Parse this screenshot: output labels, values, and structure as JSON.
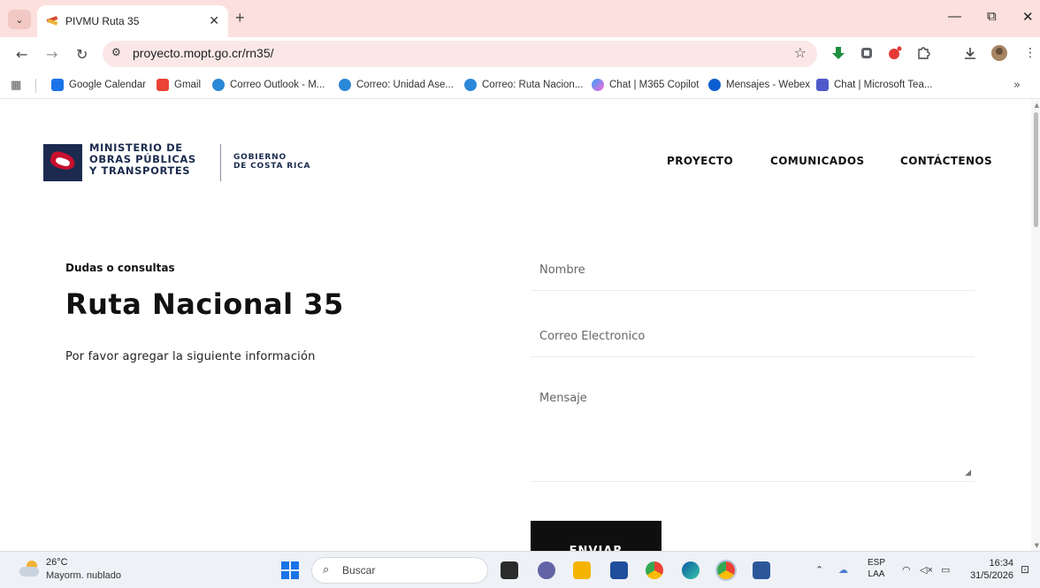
{
  "browser": {
    "tab_title": "PIVMU Ruta 35",
    "tab_close": "✕",
    "new_tab": "+",
    "url": "proyecto.mopt.go.cr/rn35/",
    "window_controls": {
      "minimize": "—",
      "restore": "⧉",
      "close": "✕"
    },
    "bookmarks": [
      {
        "label": "Google Calendar",
        "icon": "calendar-icon",
        "color": "#1a73e8"
      },
      {
        "label": "Gmail",
        "icon": "gmail-icon",
        "color": "#ea4335"
      },
      {
        "label": "Correo Outlook - M...",
        "icon": "outlook-icon",
        "color": "#2b88d8"
      },
      {
        "label": "Correo: Unidad Ase...",
        "icon": "outlook-icon",
        "color": "#2b88d8"
      },
      {
        "label": "Correo: Ruta Nacion...",
        "icon": "outlook-icon",
        "color": "#2b88d8"
      },
      {
        "label": "Chat | M365 Copilot",
        "icon": "copilot-icon",
        "color": "#7b61ff"
      },
      {
        "label": "Mensajes - Webex",
        "icon": "webex-icon",
        "color": "#0d5fd1"
      },
      {
        "label": "Chat | Microsoft Tea...",
        "icon": "teams-icon",
        "color": "#5059c9"
      }
    ],
    "bookmarks_overflow": "»"
  },
  "site": {
    "logo": {
      "ministry_lines": [
        "MINISTERIO DE",
        "OBRAS PÚBLICAS",
        "Y TRANSPORTES"
      ],
      "gov_lines": [
        "GOBIERNO",
        "DE COSTA RICA"
      ]
    },
    "nav": [
      "PROYECTO",
      "COMUNICADOS",
      "CONTÁCTENOS"
    ]
  },
  "contact": {
    "eyebrow": "Dudas o consultas",
    "title": "Ruta Nacional 35",
    "subtitle": "Por favor agregar la siguiente información",
    "form": {
      "name_placeholder": "Nombre",
      "email_placeholder": "Correo Electronico",
      "message_placeholder": "Mensaje",
      "submit_label": "ENVIAR"
    }
  },
  "taskbar": {
    "weather_temp": "26°C",
    "weather_desc": "Mayorm. nublado",
    "search_label": "Buscar",
    "lang_top": "ESP",
    "lang_bottom": "LAA",
    "time": "16:34",
    "date": "31/5/2026"
  },
  "colors": {
    "tabstrip": "#fbe0dd",
    "brand_navy": "#1b2a4e",
    "brand_red": "#c8102e",
    "button": "#0f0f0f"
  }
}
